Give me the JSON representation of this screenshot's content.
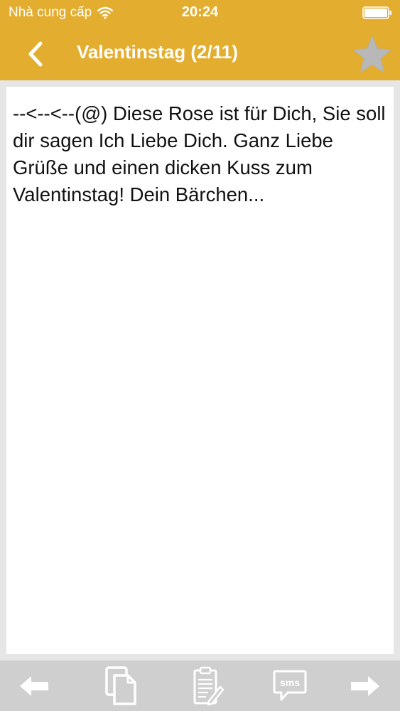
{
  "status_bar": {
    "carrier": "Nhà cung cấp",
    "time": "20:24",
    "wifi_icon": "wifi-icon",
    "battery_icon": "battery-icon"
  },
  "navbar": {
    "title": "Valentinstag (2/11)",
    "back_icon": "chevron-left-icon",
    "favorite_icon": "star-icon"
  },
  "message": {
    "text": "--<--<--(@) Diese Rose ist für Dich, Sie soll dir sagen Ich Liebe Dich. Ganz Liebe Grüße und einen dicken Kuss zum Valentinstag! Dein Bärchen..."
  },
  "toolbar": {
    "items": [
      {
        "icon": "arrow-left-icon"
      },
      {
        "icon": "copy-icon"
      },
      {
        "icon": "clipboard-edit-icon"
      },
      {
        "icon": "sms-icon",
        "label": "sms"
      },
      {
        "icon": "arrow-right-icon"
      }
    ]
  },
  "colors": {
    "header": "#e3ad2f",
    "background": "#e6e6e6",
    "toolbar": "#cfcfcf",
    "toolbar_icon": "#ffffff",
    "star_inactive": "#b8b8b8"
  }
}
